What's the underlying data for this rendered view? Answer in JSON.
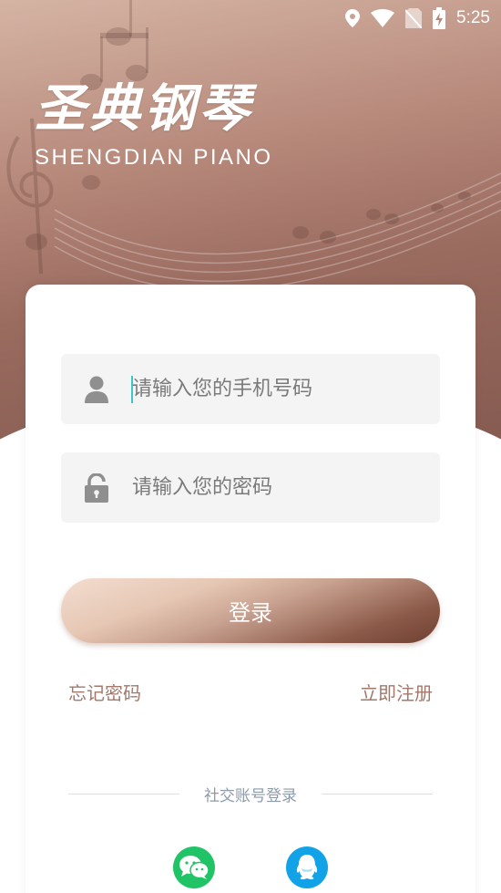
{
  "status_bar": {
    "time": "5:25",
    "icons": [
      "location-icon",
      "wifi-icon",
      "no-sim-icon",
      "battery-charging-icon"
    ]
  },
  "brand": {
    "title_cn": "圣典钢琴",
    "title_en": "SHENGDIAN PIANO"
  },
  "form": {
    "phone_placeholder": "请输入您的手机号码",
    "phone_value": "",
    "password_placeholder": "请输入您的密码",
    "password_value": "",
    "login_label": "登录",
    "forgot_label": "忘记密码",
    "register_label": "立即注册"
  },
  "social": {
    "divider_label": "社交账号登录",
    "providers": [
      "wechat-icon",
      "qq-icon"
    ]
  },
  "colors": {
    "accent": "#a3786b",
    "header_dark": "#845a50",
    "wechat": "#20c365",
    "qq": "#12a2e8"
  }
}
